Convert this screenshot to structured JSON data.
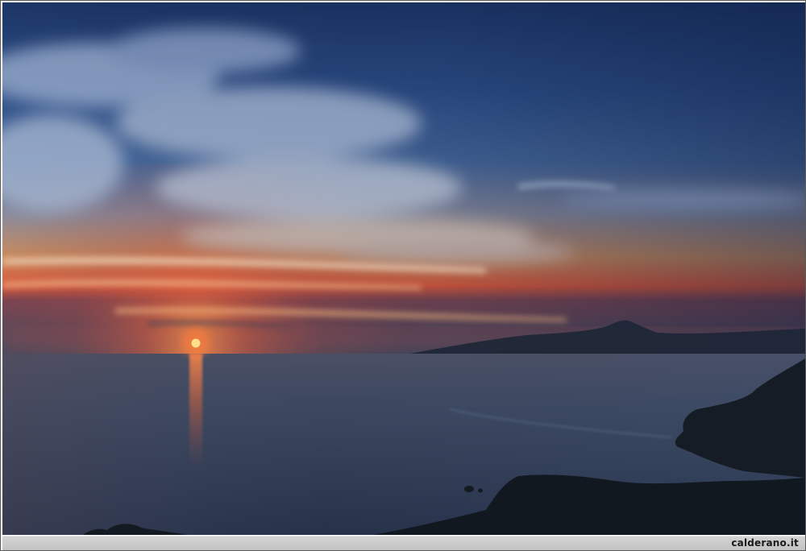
{
  "watermark": {
    "text": "calderano.it"
  },
  "scene": {
    "subject_icon": "sunset-over-sea",
    "colors": {
      "sky_top": "#1f3e78",
      "sky_mid": "#3b5f93",
      "horizon_glow": "#e0543a",
      "sun": "#ffe08a",
      "sea": "#3d4a5e",
      "land_silhouette": "#141a22",
      "caption_bar": "#c9c9c9"
    }
  }
}
